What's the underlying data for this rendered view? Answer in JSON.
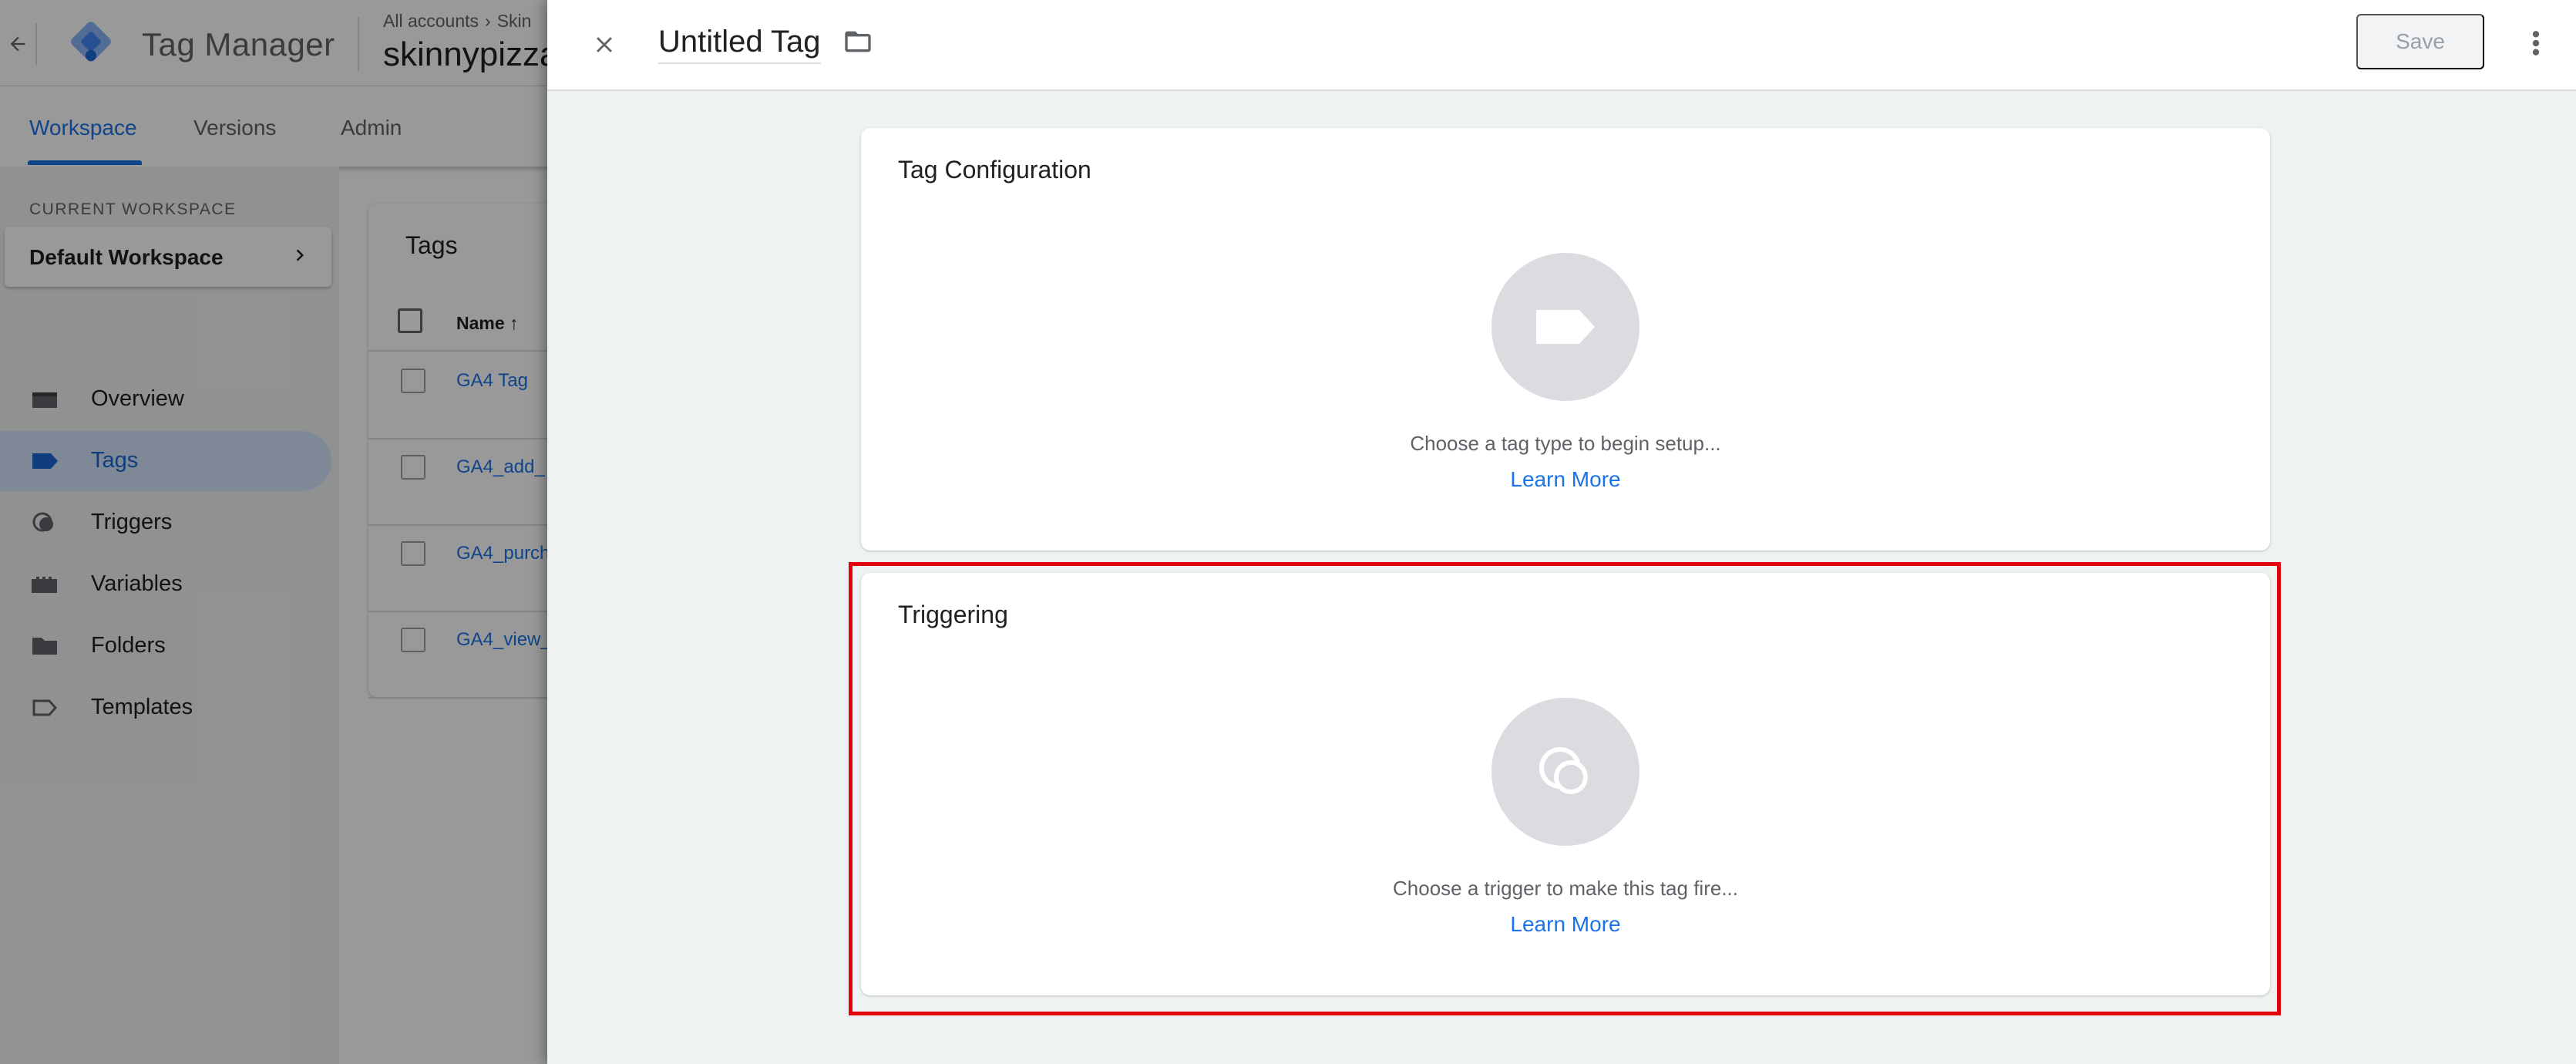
{
  "app": {
    "name": "Tag Manager",
    "breadcrumb": [
      "All accounts",
      "Skin"
    ],
    "container_name": "skinnypizza"
  },
  "tabs": [
    {
      "label": "Workspace",
      "active": true
    },
    {
      "label": "Versions",
      "active": false
    },
    {
      "label": "Admin",
      "active": false
    }
  ],
  "sidebar": {
    "workspace_label": "CURRENT WORKSPACE",
    "workspace_name": "Default Workspace",
    "items": [
      {
        "label": "Overview",
        "icon": "overview-icon",
        "active": false
      },
      {
        "label": "Tags",
        "icon": "tag-icon",
        "active": true
      },
      {
        "label": "Triggers",
        "icon": "trigger-icon",
        "active": false
      },
      {
        "label": "Variables",
        "icon": "variables-icon",
        "active": false
      },
      {
        "label": "Folders",
        "icon": "folder-icon",
        "active": false
      },
      {
        "label": "Templates",
        "icon": "template-icon",
        "active": false
      }
    ]
  },
  "tags_list": {
    "title": "Tags",
    "column_name": "Name",
    "rows": [
      "GA4 Tag",
      "GA4_add_",
      "GA4_purch",
      "GA4_view_"
    ]
  },
  "editor": {
    "tag_name": "Untitled Tag",
    "save_label": "Save",
    "tag_configuration": {
      "title": "Tag Configuration",
      "hint": "Choose a tag type to begin setup...",
      "learn_more": "Learn More"
    },
    "triggering": {
      "title": "Triggering",
      "hint": "Choose a trigger to make this tag fire...",
      "learn_more": "Learn More"
    }
  },
  "colors": {
    "accent": "#1a73e8",
    "highlight": "#e3000b",
    "active_nav_bg": "#d2e3fc",
    "panel_bg": "#eff2f3"
  }
}
